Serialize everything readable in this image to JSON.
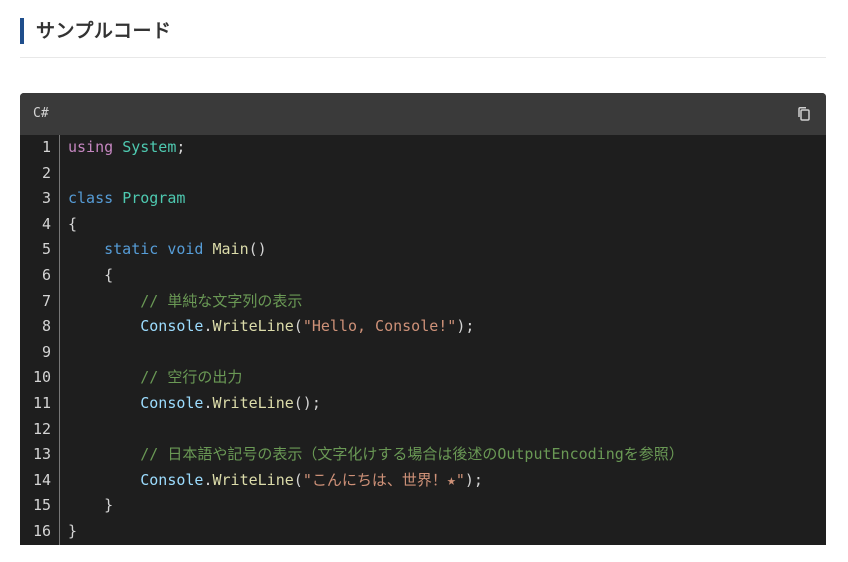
{
  "section": {
    "title": "サンプルコード"
  },
  "code_block": {
    "language": "C#",
    "copy_icon": "copy-icon",
    "line_numbers": [
      "1",
      "2",
      "3",
      "4",
      "5",
      "6",
      "7",
      "8",
      "9",
      "10",
      "11",
      "12",
      "13",
      "14",
      "15",
      "16"
    ],
    "lines": [
      [
        {
          "t": "using",
          "c": "kw"
        },
        {
          "t": " ",
          "c": "punc"
        },
        {
          "t": "System",
          "c": "type"
        },
        {
          "t": ";",
          "c": "punc"
        }
      ],
      [],
      [
        {
          "t": "class",
          "c": "kw2"
        },
        {
          "t": " ",
          "c": "punc"
        },
        {
          "t": "Program",
          "c": "type"
        }
      ],
      [
        {
          "t": "{",
          "c": "punc"
        }
      ],
      [
        {
          "t": "    ",
          "c": "punc"
        },
        {
          "t": "static",
          "c": "kw2"
        },
        {
          "t": " ",
          "c": "punc"
        },
        {
          "t": "void",
          "c": "kw2"
        },
        {
          "t": " ",
          "c": "punc"
        },
        {
          "t": "Main",
          "c": "fn"
        },
        {
          "t": "()",
          "c": "punc"
        }
      ],
      [
        {
          "t": "    {",
          "c": "punc"
        }
      ],
      [
        {
          "t": "        ",
          "c": "punc"
        },
        {
          "t": "// 単純な文字列の表示",
          "c": "cmt"
        }
      ],
      [
        {
          "t": "        ",
          "c": "punc"
        },
        {
          "t": "Console",
          "c": "var"
        },
        {
          "t": ".",
          "c": "punc"
        },
        {
          "t": "WriteLine",
          "c": "fn"
        },
        {
          "t": "(",
          "c": "punc"
        },
        {
          "t": "\"Hello, Console!\"",
          "c": "str"
        },
        {
          "t": ");",
          "c": "punc"
        }
      ],
      [],
      [
        {
          "t": "        ",
          "c": "punc"
        },
        {
          "t": "// 空行の出力",
          "c": "cmt"
        }
      ],
      [
        {
          "t": "        ",
          "c": "punc"
        },
        {
          "t": "Console",
          "c": "var"
        },
        {
          "t": ".",
          "c": "punc"
        },
        {
          "t": "WriteLine",
          "c": "fn"
        },
        {
          "t": "();",
          "c": "punc"
        }
      ],
      [],
      [
        {
          "t": "        ",
          "c": "punc"
        },
        {
          "t": "// 日本語や記号の表示（文字化けする場合は後述のOutputEncodingを参照）",
          "c": "cmt"
        }
      ],
      [
        {
          "t": "        ",
          "c": "punc"
        },
        {
          "t": "Console",
          "c": "var"
        },
        {
          "t": ".",
          "c": "punc"
        },
        {
          "t": "WriteLine",
          "c": "fn"
        },
        {
          "t": "(",
          "c": "punc"
        },
        {
          "t": "\"こんにちは、世界！★\"",
          "c": "str"
        },
        {
          "t": ");",
          "c": "punc"
        }
      ],
      [
        {
          "t": "    }",
          "c": "punc"
        }
      ],
      [
        {
          "t": "}",
          "c": "punc"
        }
      ]
    ]
  },
  "colors": {
    "heading_accent": "#1f4e8c",
    "code_bg": "#1e1e1e",
    "header_bg": "#3a3a3a"
  }
}
